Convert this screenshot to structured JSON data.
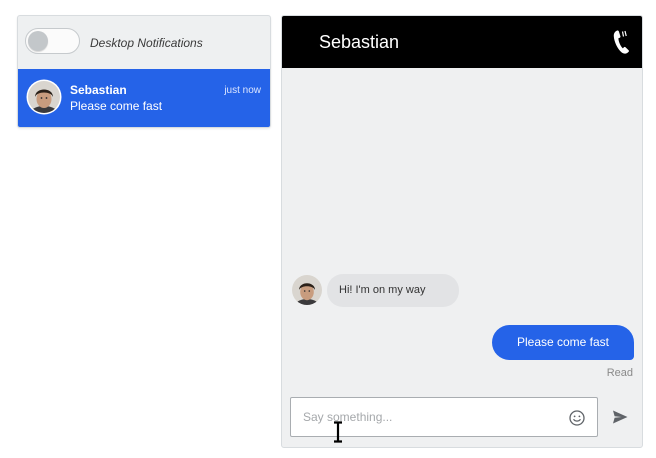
{
  "sidebar": {
    "notifications": {
      "label": "Desktop Notifications",
      "enabled": false
    },
    "contacts": [
      {
        "name": "Sebastian",
        "time": "just now",
        "preview": "Please come fast",
        "avatar": "profile-photo"
      }
    ]
  },
  "chat": {
    "title": "Sebastian",
    "call_icon": "phone-icon",
    "messages": [
      {
        "direction": "incoming",
        "text": "Hi! I'm on my way"
      },
      {
        "direction": "outgoing",
        "text": "Please come fast"
      }
    ],
    "read_status": "Read",
    "input": {
      "placeholder": "Say something...",
      "value": ""
    },
    "emoji_icon": "smile-icon",
    "send_icon": "send-icon"
  },
  "colors": {
    "accent": "#2563e8",
    "header": "#000000",
    "chat_background": "#eff0f1",
    "incoming_bubble": "#e2e3e5"
  }
}
